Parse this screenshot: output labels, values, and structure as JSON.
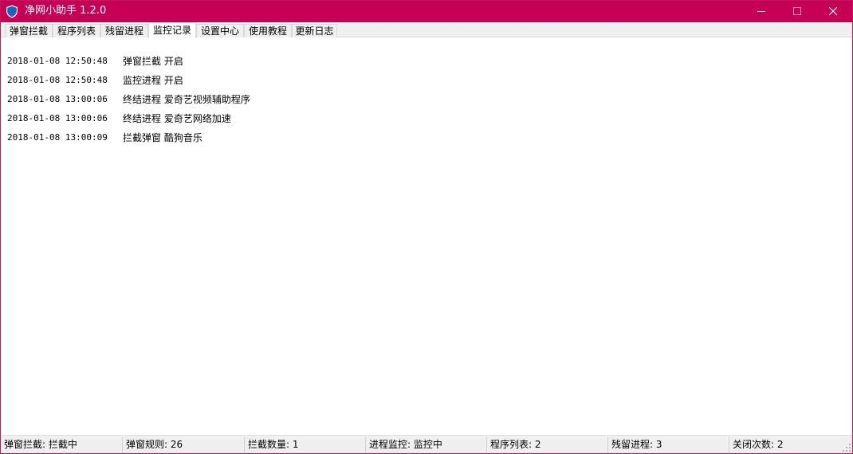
{
  "window": {
    "title": "净网小助手 1.2.0",
    "app_icon": "shield-icon",
    "controls": {
      "minimize": "minimize-icon",
      "maximize": "maximize-icon",
      "close": "close-icon"
    },
    "accent_color": "#c50055"
  },
  "tabs": [
    {
      "label": "弹窗拦截",
      "active": false
    },
    {
      "label": "程序列表",
      "active": false
    },
    {
      "label": "残留进程",
      "active": false
    },
    {
      "label": "监控记录",
      "active": true
    },
    {
      "label": "设置中心",
      "active": false
    },
    {
      "label": "使用教程",
      "active": false
    },
    {
      "label": "更新日志",
      "active": false
    }
  ],
  "log": [
    {
      "time": "2018-01-08 12:50:48",
      "message": "弹窗拦截 开启"
    },
    {
      "time": "2018-01-08 12:50:48",
      "message": "监控进程 开启"
    },
    {
      "time": "2018-01-08 13:00:06",
      "message": "终结进程 爱奇艺视频辅助程序"
    },
    {
      "time": "2018-01-08 13:00:06",
      "message": "终结进程 爱奇艺网络加速"
    },
    {
      "time": "2018-01-08 13:00:09",
      "message": "拦截弹窗 酷狗音乐"
    }
  ],
  "status": [
    "弹窗拦截: 拦截中",
    "弹窗规则: 26",
    "拦截数量: 1",
    "进程监控: 监控中",
    "程序列表: 2",
    "残留进程: 3",
    "关闭次数: 2"
  ]
}
